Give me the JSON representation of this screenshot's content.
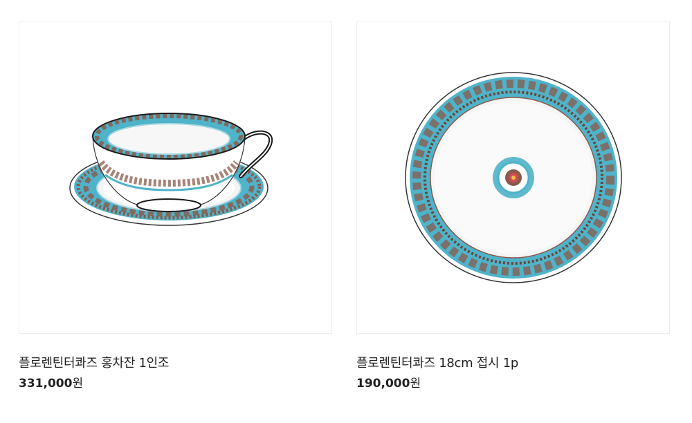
{
  "products": [
    {
      "name": "플로렌틴터콰즈 홍차잔 1인조",
      "price": "331,000",
      "currency": "원",
      "image_icon": "teacup-saucer-image"
    },
    {
      "name": "플로렌틴터콰즈 18cm 접시 1p",
      "price": "190,000",
      "currency": "원",
      "image_icon": "plate-image"
    }
  ],
  "colors": {
    "turquoise": "#4fb3c9",
    "pattern_brown": "#8a5a4a",
    "text": "#222222",
    "border": "#ececec"
  }
}
